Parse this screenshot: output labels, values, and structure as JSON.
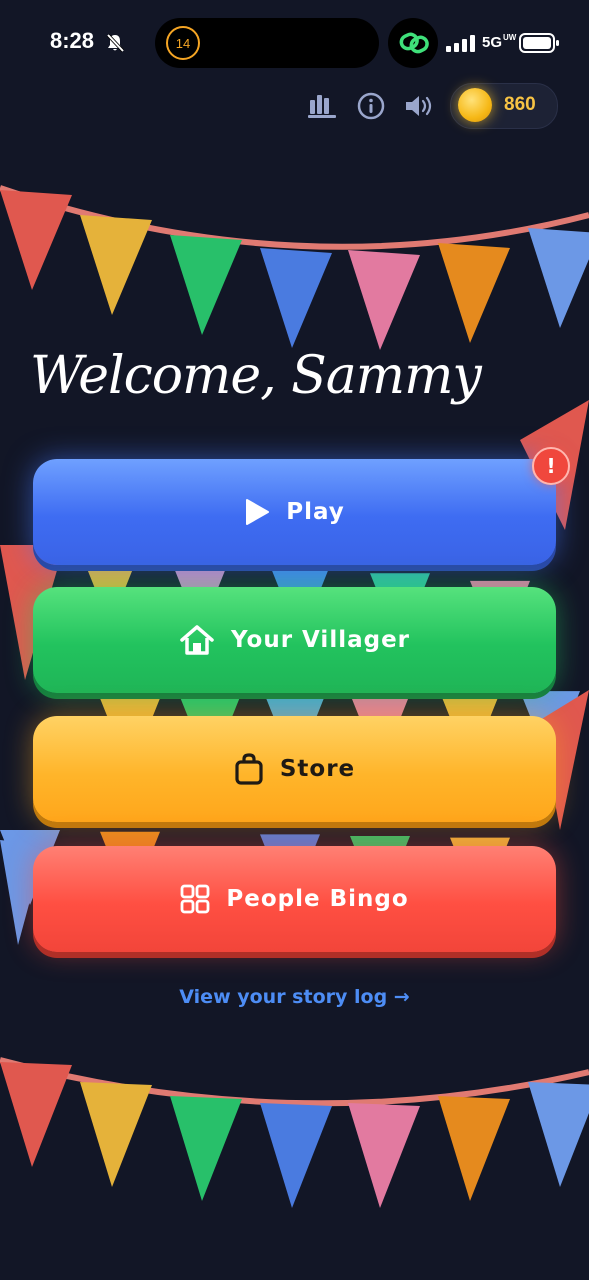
{
  "status_bar": {
    "time": "8:28",
    "timer_value": "14",
    "network": "5G",
    "network_suffix": "UW"
  },
  "header": {
    "coins": "860"
  },
  "welcome_text": "Welcome, Sammy",
  "menu": {
    "play_label": "Play",
    "villager_label": "Your Villager",
    "store_label": "Store",
    "bingo_label": "People Bingo"
  },
  "alert_badge": "!",
  "story_link": "View your story log →",
  "colors": {
    "background": "#121626",
    "play": "#3e6cf2",
    "villager": "#22c35e",
    "store": "#ffb52a",
    "bingo": "#ff4f42",
    "coin": "#f6b816",
    "link": "#4d8df5"
  }
}
